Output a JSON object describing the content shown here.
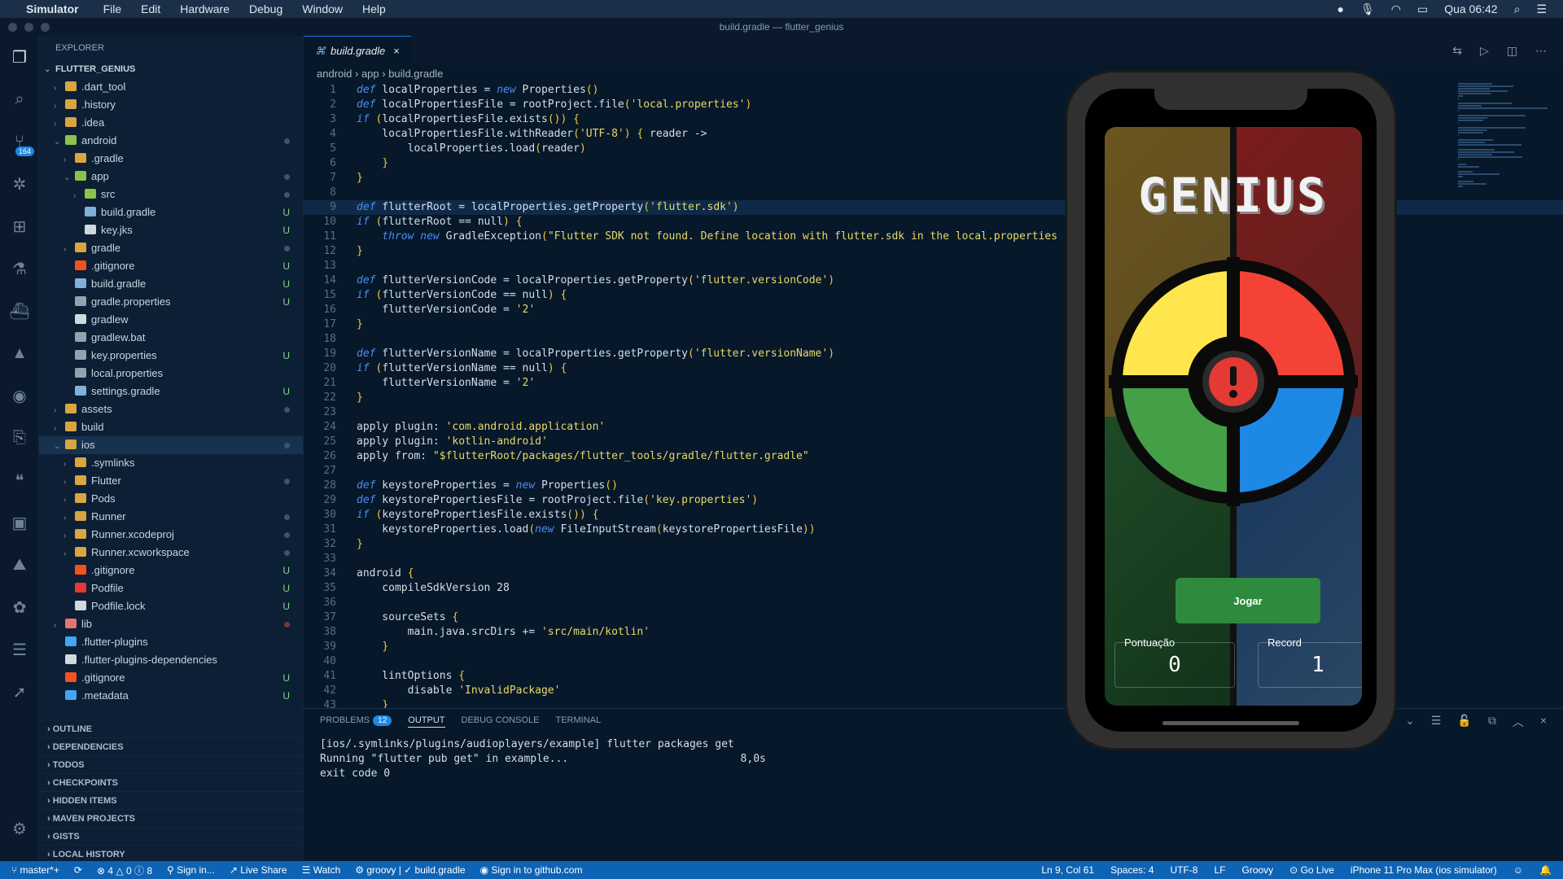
{
  "menubar": {
    "app": "Simulator",
    "items": [
      "File",
      "Edit",
      "Hardware",
      "Debug",
      "Window",
      "Help"
    ],
    "clock": "Qua 06:42"
  },
  "window_title": "build.gradle — flutter_genius",
  "activity": {
    "source_control_badge": "164"
  },
  "explorer": {
    "header": "EXPLORER",
    "root": "FLUTTER_GENIUS",
    "items": [
      {
        "label": ".dart_tool",
        "depth": 1,
        "kind": "folder",
        "exp": false,
        "st": ""
      },
      {
        "label": ".history",
        "depth": 1,
        "kind": "folder",
        "exp": false,
        "st": ""
      },
      {
        "label": ".idea",
        "depth": 1,
        "kind": "folder",
        "exp": false,
        "st": ""
      },
      {
        "label": "android",
        "depth": 1,
        "kind": "folder-android",
        "exp": true,
        "st": "dot"
      },
      {
        "label": ".gradle",
        "depth": 2,
        "kind": "folder",
        "exp": false,
        "st": ""
      },
      {
        "label": "app",
        "depth": 2,
        "kind": "folder-android",
        "exp": true,
        "st": "dot"
      },
      {
        "label": "src",
        "depth": 3,
        "kind": "folder-android",
        "exp": false,
        "st": "dot"
      },
      {
        "label": "build.gradle",
        "depth": 3,
        "kind": "gradle",
        "exp": null,
        "st": "U"
      },
      {
        "label": "key.jks",
        "depth": 3,
        "kind": "file",
        "exp": null,
        "st": "U"
      },
      {
        "label": "gradle",
        "depth": 2,
        "kind": "folder",
        "exp": false,
        "st": "dot"
      },
      {
        "label": ".gitignore",
        "depth": 2,
        "kind": "git",
        "exp": null,
        "st": "U"
      },
      {
        "label": "build.gradle",
        "depth": 2,
        "kind": "gradle",
        "exp": null,
        "st": "U"
      },
      {
        "label": "gradle.properties",
        "depth": 2,
        "kind": "gear",
        "exp": null,
        "st": "U"
      },
      {
        "label": "gradlew",
        "depth": 2,
        "kind": "file",
        "exp": null,
        "st": ""
      },
      {
        "label": "gradlew.bat",
        "depth": 2,
        "kind": "gear",
        "exp": null,
        "st": ""
      },
      {
        "label": "key.properties",
        "depth": 2,
        "kind": "gear",
        "exp": null,
        "st": "U"
      },
      {
        "label": "local.properties",
        "depth": 2,
        "kind": "gear",
        "exp": null,
        "st": ""
      },
      {
        "label": "settings.gradle",
        "depth": 2,
        "kind": "gradle",
        "exp": null,
        "st": "U"
      },
      {
        "label": "assets",
        "depth": 1,
        "kind": "folder",
        "exp": false,
        "st": "dot"
      },
      {
        "label": "build",
        "depth": 1,
        "kind": "folder",
        "exp": false,
        "st": ""
      },
      {
        "label": "ios",
        "depth": 1,
        "kind": "folder",
        "exp": true,
        "st": "dot",
        "sel": true
      },
      {
        "label": ".symlinks",
        "depth": 2,
        "kind": "folder",
        "exp": false,
        "st": ""
      },
      {
        "label": "Flutter",
        "depth": 2,
        "kind": "folder",
        "exp": false,
        "st": "dot"
      },
      {
        "label": "Pods",
        "depth": 2,
        "kind": "folder",
        "exp": false,
        "st": ""
      },
      {
        "label": "Runner",
        "depth": 2,
        "kind": "folder",
        "exp": false,
        "st": "dot"
      },
      {
        "label": "Runner.xcodeproj",
        "depth": 2,
        "kind": "folder",
        "exp": false,
        "st": "dot"
      },
      {
        "label": "Runner.xcworkspace",
        "depth": 2,
        "kind": "folder",
        "exp": false,
        "st": "dot"
      },
      {
        "label": ".gitignore",
        "depth": 2,
        "kind": "git",
        "exp": null,
        "st": "U"
      },
      {
        "label": "Podfile",
        "depth": 2,
        "kind": "ruby",
        "exp": null,
        "st": "U"
      },
      {
        "label": "Podfile.lock",
        "depth": 2,
        "kind": "file",
        "exp": null,
        "st": "U"
      },
      {
        "label": "lib",
        "depth": 1,
        "kind": "folder-lib",
        "exp": false,
        "st": "dotred"
      },
      {
        "label": ".flutter-plugins",
        "depth": 1,
        "kind": "flutter",
        "exp": null,
        "st": ""
      },
      {
        "label": ".flutter-plugins-dependencies",
        "depth": 1,
        "kind": "file",
        "exp": null,
        "st": ""
      },
      {
        "label": ".gitignore",
        "depth": 1,
        "kind": "git",
        "exp": null,
        "st": "U"
      },
      {
        "label": ".metadata",
        "depth": 1,
        "kind": "flutter",
        "exp": null,
        "st": "U"
      }
    ],
    "sections": [
      "OUTLINE",
      "DEPENDENCIES",
      "TODOS",
      "CHECKPOINTS",
      "HIDDEN ITEMS",
      "MAVEN PROJECTS",
      "GISTS",
      "LOCAL HISTORY"
    ]
  },
  "editor": {
    "tab": "build.gradle",
    "breadcrumb": [
      "android",
      "app",
      "build.gradle"
    ],
    "highlight_line": 9,
    "lines": [
      "def localProperties = new Properties()",
      "def localPropertiesFile = rootProject.file('local.properties')",
      "if (localPropertiesFile.exists()) {",
      "    localPropertiesFile.withReader('UTF-8') { reader ->",
      "        localProperties.load(reader)",
      "    }",
      "}",
      "",
      "def flutterRoot = localProperties.getProperty('flutter.sdk')",
      "if (flutterRoot == null) {",
      "    throw new GradleException(\"Flutter SDK not found. Define location with flutter.sdk in the local.properties file.\")",
      "}",
      "",
      "def flutterVersionCode = localProperties.getProperty('flutter.versionCode')",
      "if (flutterVersionCode == null) {",
      "    flutterVersionCode = '2'",
      "}",
      "",
      "def flutterVersionName = localProperties.getProperty('flutter.versionName')",
      "if (flutterVersionName == null) {",
      "    flutterVersionName = '2'",
      "}",
      "",
      "apply plugin: 'com.android.application'",
      "apply plugin: 'kotlin-android'",
      "apply from: \"$flutterRoot/packages/flutter_tools/gradle/flutter.gradle\"",
      "",
      "def keystoreProperties = new Properties()",
      "def keystorePropertiesFile = rootProject.file('key.properties')",
      "if (keystorePropertiesFile.exists()) {",
      "    keystoreProperties.load(new FileInputStream(keystorePropertiesFile))",
      "}",
      "",
      "android {",
      "    compileSdkVersion 28",
      "",
      "    sourceSets {",
      "        main.java.srcDirs += 'src/main/kotlin'",
      "    }",
      "",
      "    lintOptions {",
      "        disable 'InvalidPackage'",
      "    }"
    ]
  },
  "panel": {
    "tabs": [
      "PROBLEMS",
      "OUTPUT",
      "DEBUG CONSOLE",
      "TERMINAL"
    ],
    "problems_count": "12",
    "active": "OUTPUT",
    "output": "[ios/.symlinks/plugins/audioplayers/example] flutter packages get\nRunning \"flutter pub get\" in example...                           8,0s\nexit code 0"
  },
  "statusbar": {
    "branch": "master*+",
    "errors": "4",
    "warnings": "0",
    "info": "8",
    "signin": "Sign in...",
    "liveshare": "Live Share",
    "watch": "Watch",
    "lang_file": "groovy | ✓ build.gradle",
    "github": "Sign in to github.com",
    "position": "Ln 9, Col 61",
    "spaces": "Spaces: 4",
    "encoding": "UTF-8",
    "eol": "LF",
    "language": "Groovy",
    "golive": "Go Live",
    "device": "iPhone 11 Pro Max (ios simulator)"
  },
  "app": {
    "title": "GENIUS",
    "play": "Jogar",
    "score_label": "Pontuação",
    "score": "0",
    "record_label": "Record",
    "record": "1",
    "colors": {
      "yellow": "#ffe64d",
      "red": "#f44336",
      "green": "#43a047",
      "blue": "#1e88e5",
      "center": "#e53935"
    }
  }
}
